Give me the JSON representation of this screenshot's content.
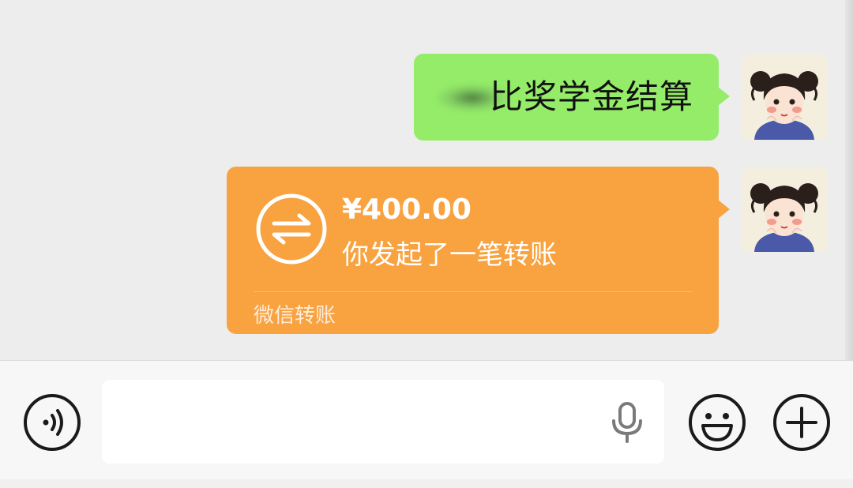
{
  "messages": [
    {
      "type": "text",
      "text": "比奖学金结算",
      "partially_obscured": true
    },
    {
      "type": "transfer",
      "amount": "¥400.00",
      "description": "你发起了一笔转账",
      "footer": "微信转账",
      "icon": "transfer-arrows-icon"
    }
  ],
  "colors": {
    "chat_background": "#ededed",
    "text_bubble": "#95ec69",
    "transfer_bubble": "#f9a240",
    "input_bar": "#f7f7f7"
  },
  "input_bar": {
    "voice_icon": "voice-icon",
    "text_value": "",
    "mic_icon": "microphone-icon",
    "emoji_icon": "emoji-icon",
    "more_icon": "plus-icon"
  },
  "avatar": {
    "icon": "cartoon-girl-avatar"
  }
}
